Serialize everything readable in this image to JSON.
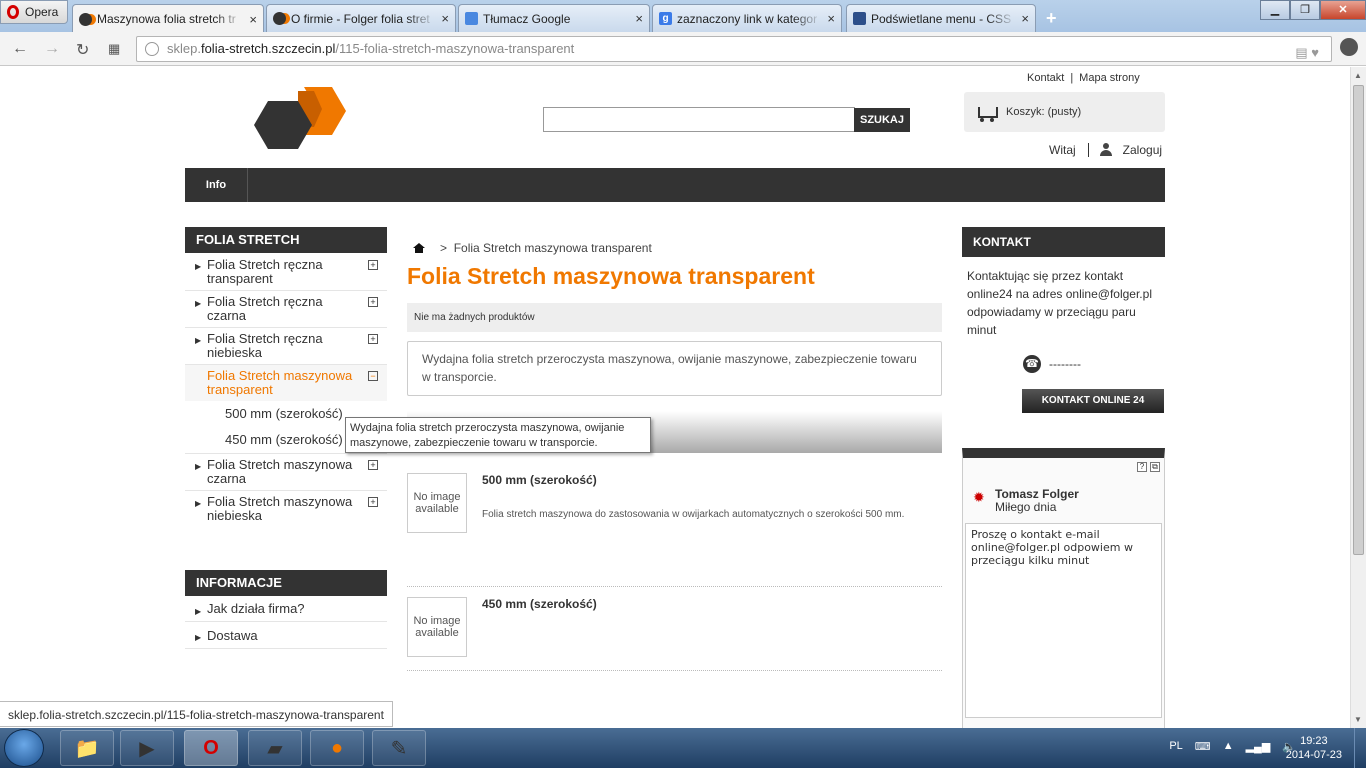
{
  "browser": {
    "menu_label": "Opera",
    "tabs": [
      {
        "title": "Maszynowa folia stretch tr",
        "icon": "folger-favicon",
        "active": true
      },
      {
        "title": "O firmie - Folger folia stret",
        "icon": "folger-favicon",
        "active": false
      },
      {
        "title": "Tłumacz Google",
        "icon": "translate-favicon",
        "active": false
      },
      {
        "title": "zaznaczony link w kategor",
        "icon": "google-favicon",
        "active": false
      },
      {
        "title": "Podświetlane menu - CSS",
        "icon": "css-favicon",
        "active": false
      }
    ],
    "new_tab": "+",
    "close_glyph": "×",
    "google_glyph": "g",
    "url_prefix": "sklep.",
    "url_domain": "folia-stretch.szczecin.pl",
    "url_path": "/115-folia-stretch-maszynowa-transparent",
    "status_url": "sklep.folia-stretch.szczecin.pl/115-folia-stretch-maszynowa-transparent"
  },
  "header": {
    "links": [
      "Kontakt",
      "Mapa strony"
    ],
    "link_sep": "|",
    "search_button": "SZUKAJ",
    "search_value": "",
    "cart_label": "Koszyk:",
    "cart_state": "(pusty)",
    "welcome": "Witaj",
    "login": "Zaloguj"
  },
  "menu": {
    "items": [
      "Info"
    ]
  },
  "sidebar": {
    "categories_title": "FOLIA STRETCH",
    "categories": [
      {
        "label": "Folia Stretch ręczna transparent",
        "toggle": "+"
      },
      {
        "label": "Folia Stretch ręczna czarna",
        "toggle": "+"
      },
      {
        "label": "Folia Stretch ręczna niebieska",
        "toggle": "+"
      },
      {
        "label": "Folia Stretch maszynowa transparent",
        "toggle": "−",
        "active": true
      },
      {
        "label": "Folia Stretch maszynowa czarna",
        "toggle": "+"
      },
      {
        "label": "Folia Stretch maszynowa niebieska",
        "toggle": "+"
      }
    ],
    "subcategories": [
      "500 mm (szerokość)",
      "450 mm (szerokość)"
    ],
    "info_title": "INFORMACJE",
    "info_links": [
      "Jak działa firma?",
      "Dostawa"
    ],
    "tooltip": "Wydajna folia stretch przeroczysta maszynowa, owijanie maszynowe, zabezpieczenie towaru w transporcie."
  },
  "main": {
    "breadcrumb_sep": ">",
    "breadcrumb": "Folia Stretch maszynowa transparent",
    "title": "Folia Stretch maszynowa transparent",
    "no_products": "Nie ma żadnych produktów",
    "description": "Wydajna folia stretch przeroczysta maszynowa, owijanie maszynowe, zabezpieczenie towaru w transporcie.",
    "products": [
      {
        "name": "500 mm (szerokość)",
        "image_text": "No image available",
        "description": "Folia stretch maszynowa do zastosowania w owijarkach automatycznych o szerokości 500 mm."
      },
      {
        "name": "450 mm (szerokość)",
        "image_text": "No image available",
        "description": ""
      }
    ]
  },
  "right": {
    "kontakt_title": "KONTAKT",
    "kontakt_text": "Kontaktując się przez kontakt online24 na adres online@folger.pl odpowiadamy w przeciągu paru minut",
    "phone": "--------",
    "kontakt_button": "KONTAKT ONLINE 24",
    "chat_name": "Tomasz Folger",
    "chat_status": "Miłego dnia",
    "chat_message": "Proszę o kontakt e-mail online@folger.pl odpowiem w przeciągu kilku minut"
  },
  "taskbar": {
    "language": "PL",
    "time": "19:23",
    "date": "2014-07-23"
  },
  "colors": {
    "accent": "#f07800",
    "dark": "#333333"
  }
}
